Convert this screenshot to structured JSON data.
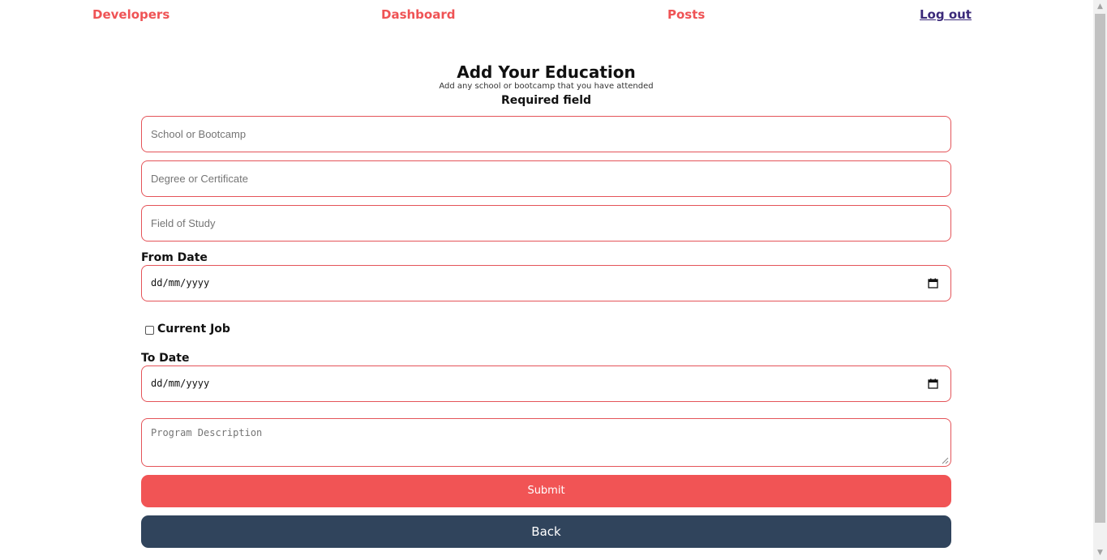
{
  "nav": {
    "developers": "Developers",
    "dashboard": "Dashboard",
    "posts": "Posts",
    "logout": "Log out"
  },
  "header": {
    "title": "Add Your Education",
    "subtitle": "Add any school or bootcamp that you have attended",
    "required": "Required field"
  },
  "form": {
    "school_placeholder": "School or Bootcamp",
    "degree_placeholder": "Degree or Certificate",
    "field_of_study_placeholder": "Field of Study",
    "from_date_label": "From Date",
    "from_date_value": "dd/mm/yyyy",
    "current_job_label": "Current Job",
    "current_job_checked": false,
    "to_date_label": "To Date",
    "to_date_value": "dd/mm/yyyy",
    "description_placeholder": "Program Description",
    "submit_label": "Submit",
    "back_label": "Back"
  },
  "colors": {
    "accent": "#f15455",
    "border": "#e45459",
    "back_button": "#30445c",
    "logout_link": "#3b2a7a"
  }
}
